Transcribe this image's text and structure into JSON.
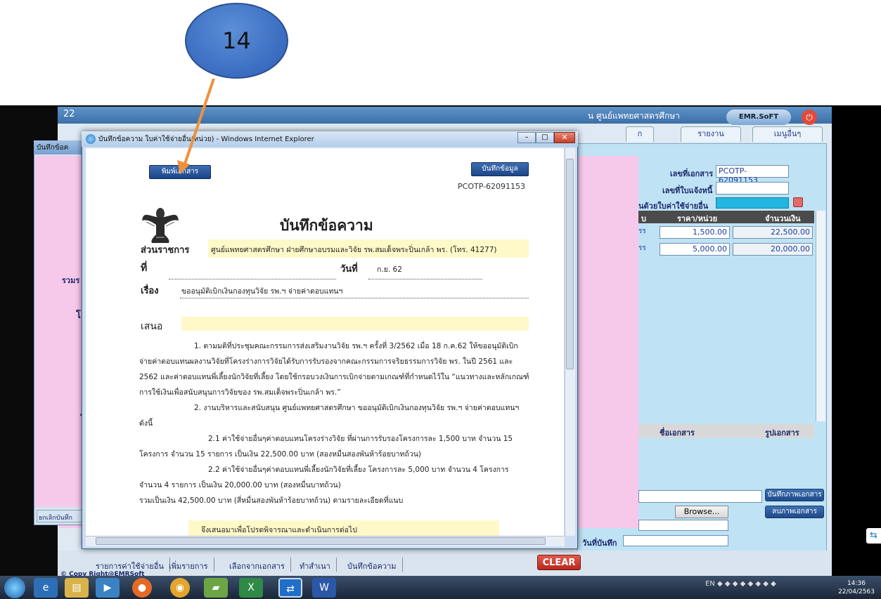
{
  "annotation": {
    "step_number": "14"
  },
  "background_app": {
    "title_left": "22",
    "title_right": "น ศูนย์แพทยศาสตรศึกษา",
    "logo": "EMR.SoFT",
    "tabs": [
      "ก",
      "รายงาน",
      "เมนูอื่นๆ"
    ],
    "left_window_title": "บันทึกข้อค",
    "left_labels": [
      "รวมร",
      "โ",
      "ใ",
      "ยกเลิกบันทึก"
    ],
    "doc_no_label": "เลขที่เอกสาร",
    "doc_no_value": "PCOTP-62091153",
    "notice_label": "เลขที่ใบแจ้งหนี้",
    "expense_label": "นด้วยใบค่าใช้จ่ายอื่น",
    "grid_headers": [
      "บ",
      "ราคา/หน่วย",
      "จำนวนเงิน"
    ],
    "grid_rows": [
      {
        "code": "รร",
        "unit_price": "1,500.00",
        "amount": "22,500.00"
      },
      {
        "code": "รร",
        "unit_price": "5,000.00",
        "amount": "20,000.00"
      }
    ],
    "grid2_headers": [
      "ชื่อเอกสาร",
      "รูปเอกสาร"
    ],
    "save_doc_button": "บันทึกภาพเอกสาร",
    "browse_button": "Browse...",
    "delete_doc_button": "ลบภาพเอกสาร",
    "save_date_label": "วันที่บันทึก",
    "bottom_nav": [
      "รายการค่าใช้จ่ายอื่น",
      "เพิ่มรายการ",
      "เลือกจากเอกสาร",
      "ทำสำเนา",
      "บันทึกข้อความ"
    ],
    "clear_button": "CLEAR",
    "footer": "© Copy Right@EMRSoft"
  },
  "ie_window": {
    "title": "บันทึกข้อความ ใบค่าใช้จ่ายอื่น(หน่วย) - Windows Internet Explorer",
    "print_button": "พิมพ์เอกสาร",
    "save_button": "บันทึกข้อมูล",
    "doc_code": "PCOTP-62091153",
    "heading": "บันทึกข้อความ",
    "agency_label": "ส่วนราชการ",
    "agency_value": "ศูนย์แพทยศาสตรศึกษา ฝ่ายศึกษาอบรมและวิจัย รพ.สมเด็จพระปิ่นเกล้า พร. (โทร. 41277)",
    "ref_label": "ที่",
    "date_label": "วันที่",
    "date_value": "ก.ย. 62",
    "subject_label": "เรื่อง",
    "subject_value": "ขออนุมัติเบิกเงินกองทุนวิจัย รพ.ฯ จ่ายค่าตอบแทนฯ",
    "propose_label": "เสนอ",
    "paragraphs": [
      "1. ตามมติที่ประชุมคณะกรรมการส่งเสริมงานวิจัย รพ.ฯ ครั้งที่ 3/2562 เมื่อ 18 ก.ค.62 ให้ขออนุมัติเบิก",
      "จ่ายค่าตอบแทนผลงานวิจัยที่โครงร่างการวิจัยได้รับการรับรองจากคณะกรรมการจริยธรรมการวิจัย พร. ในปี 2561 และ",
      "2562 และค่าตอบแทนพี่เลี้ยงนักวิจัยที่เลี้ยง โดยใช้กรอบวงเงินการเบิกจ่ายตามเกณฑ์ที่กำหนดไว้ใน “แนวทางและหลักเกณฑ์",
      "การใช้เงินเพื่อสนับสนุนการวิจัยของ รพ.สมเด็จพระปิ่นเกล้า พร.”",
      "2. งานบริหารและสนับสนุน ศูนย์แพทยศาสตรศึกษา ขออนุมัติเบิกเงินกองทุนวิจัย รพ.ฯ จ่ายค่าตอบแทนฯ",
      "ดังนี้",
      "2.1 ค่าใช้จ่ายอื่นๆค่าตอบแทนโครงร่างวิจัย ที่ผ่านการรับรองโครงการละ 1,500 บาท จำนวน 15",
      "โครงการ   จำนวน 15 รายการ  เป็นเงิน 22,500.00 บาท (สองหมื่นสองพันห้าร้อยบาทถ้วน)",
      "2.2 ค่าใช้จ่ายอื่นๆค่าตอบแทนพี่เลี้ยงนักวิจัยที่เลี้ยง โครงการละ 5,000 บาท จำนวน 4 โครงการ",
      "จำนวน 4 รายการ  เป็นเงิน 20,000.00 บาท (สองหมื่นบาทถ้วน)",
      "รวมเป็นเงิน 42,500.00 บาท (สี่หมื่นสองพันห้าร้อยบาทถ้วน) ตามรายละเอียดที่แนบ"
    ],
    "closing": "จึงเสนอมาเพื่อโปรดพิจารณาและดำเนินการต่อไป"
  },
  "taskbar": {
    "apps": [
      "ie",
      "explorer",
      "media",
      "firefox",
      "chrome",
      "folder",
      "excel",
      "teamviewer",
      "word"
    ],
    "tray_lang": "EN",
    "time": "14:36",
    "date": "22/04/2563"
  }
}
